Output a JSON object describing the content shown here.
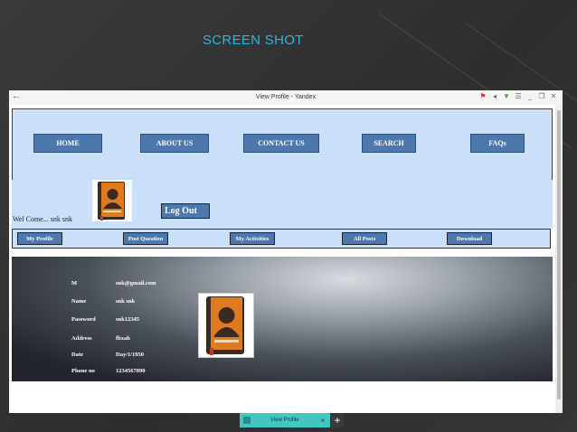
{
  "slide": {
    "title": "SCREEN SHOT"
  },
  "window": {
    "title": "View Profile - Yandex"
  },
  "nav": [
    "HOME",
    "ABOUT US",
    "CONTACT US",
    "SEARCH",
    "FAQs"
  ],
  "welcome": {
    "text": "Wel Come... snk snk",
    "logout": "Log Out"
  },
  "subnav": [
    "My Profile",
    "Post Question",
    "My Activities",
    "All Posts",
    "Download"
  ],
  "profile": {
    "rows": [
      {
        "label": "M",
        "value": "snk@gmail.com"
      },
      {
        "label": "Name",
        "value": "snk snk"
      },
      {
        "label": "Password",
        "value": "snk12345"
      },
      {
        "label": "Address",
        "value": "fhxah"
      },
      {
        "label": "Date",
        "value": "Day/1/1950"
      },
      {
        "label": "Phone no",
        "value": "1234567890"
      }
    ]
  },
  "taskbar": {
    "tab_label": "View Profile",
    "close": "×",
    "new_tab": "+"
  },
  "colors": {
    "accent": "#2fb4e0",
    "nav_bg": "#c9dffa",
    "button": "#4d78ae",
    "tab": "#41c6c0"
  }
}
